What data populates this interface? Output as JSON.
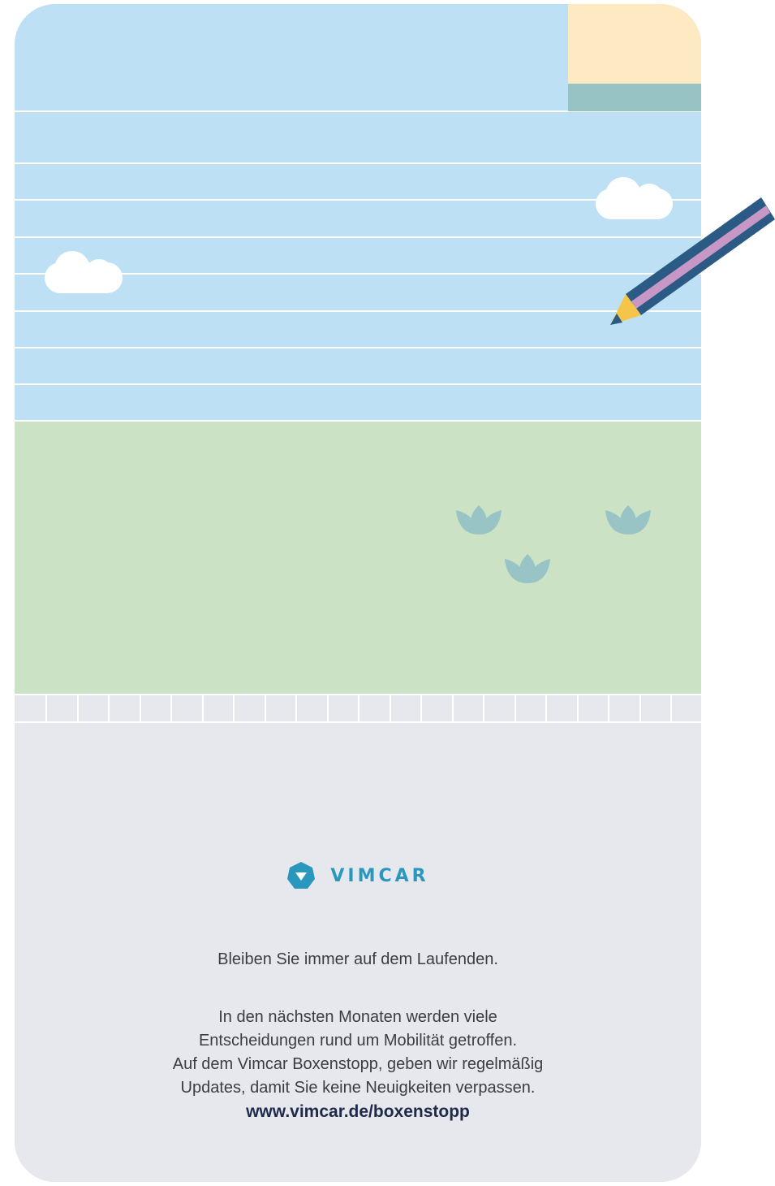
{
  "brand": {
    "name": "VIMCAR",
    "logo_icon": "vimcar-hexagon-chevron-icon",
    "color": "#2a97bd"
  },
  "footer": {
    "tagline": "Bleiben Sie immer auf dem Laufenden.",
    "paragraph_lines": [
      "In den nächsten Monaten werden viele",
      "Entscheidungen rund um Mobilität getroffen.",
      "Auf dem Vimcar Boxenstopp, geben wir regelmäßig",
      "Updates, damit Sie keine Neuigkeiten verpassen."
    ],
    "url": "www.vimcar.de/boxenstopp"
  },
  "colors": {
    "sky": "#bde0f5",
    "grass": "#cce2c4",
    "panel": "#e6e8ee",
    "sticky_note": "#fde9c2",
    "sticky_band": "#98c3c4",
    "pencil_body": "#2b5a85",
    "pencil_stripe": "#c797c6",
    "pencil_tip": "#f5c54a",
    "plant": "#98c4c6"
  },
  "illustration": {
    "icons": [
      "cloud-icon",
      "cloud-icon",
      "pencil-icon",
      "plant-icon",
      "plant-icon",
      "plant-icon",
      "sticky-note-icon"
    ]
  }
}
